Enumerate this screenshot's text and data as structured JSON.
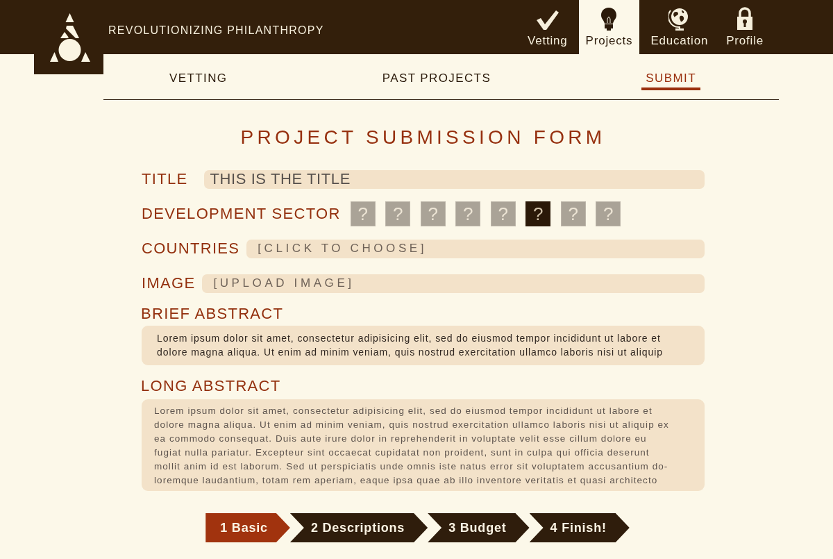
{
  "header": {
    "tagline": "REVOLUTIONIZING PHILANTHROPY"
  },
  "nav": [
    {
      "label": "Vetting",
      "selected": false
    },
    {
      "label": "Projects",
      "selected": true
    },
    {
      "label": "Education",
      "selected": false
    },
    {
      "label": "Profile",
      "selected": false
    }
  ],
  "subnav": [
    {
      "label": "VETTING",
      "selected": false
    },
    {
      "label": "PAST PROJECTS",
      "selected": false
    },
    {
      "label": "SUBMIT",
      "selected": true
    }
  ],
  "form": {
    "heading": "PROJECT SUBMISSION FORM",
    "title": {
      "label": "TITLE",
      "value": "THIS IS THE TITLE"
    },
    "sector": {
      "label": "DEVELOPMENT SECTOR",
      "options": [
        {
          "text": "?",
          "selected": false
        },
        {
          "text": "?",
          "selected": false
        },
        {
          "text": "?",
          "selected": false
        },
        {
          "text": "?",
          "selected": false
        },
        {
          "text": "?",
          "selected": false
        },
        {
          "text": "?",
          "selected": true
        },
        {
          "text": "?",
          "selected": false
        },
        {
          "text": "?",
          "selected": false
        }
      ]
    },
    "countries": {
      "label": "COUNTRIES",
      "placeholder": "[CLICK TO CHOOSE]"
    },
    "image": {
      "label": "IMAGE",
      "placeholder": "[UPLOAD IMAGE]"
    },
    "brief_abstract": {
      "label": "BRIEF ABSTRACT",
      "value": "Lorem ipsum dolor sit amet, consectetur adipisicing elit, sed do eiusmod tempor incididunt ut labore et\ndolore magna aliqua. Ut enim ad minim veniam, quis nostrud exercitation ullamco laboris nisi ut aliquip"
    },
    "long_abstract": {
      "label": "LONG ABSTRACT",
      "value": "Lorem ipsum dolor sit amet, consectetur adipisicing elit, sed do eiusmod tempor incididunt ut labore et\ndolore magna aliqua. Ut enim ad minim veniam, quis nostrud exercitation ullamco laboris nisi ut aliquip ex\nea commodo consequat. Duis aute irure dolor in reprehenderit in voluptate velit esse cillum dolore eu\nfugiat nulla pariatur. Excepteur sint occaecat cupidatat non proident, sunt in culpa qui officia deserunt\nmollit anim id est laborum. Sed ut perspiciatis unde omnis iste natus error sit voluptatem accusantium do-\nloremque laudantium, totam rem aperiam, eaque ipsa quae ab illo inventore veritatis et quasi architecto"
    }
  },
  "steps": [
    {
      "label": "1 Basic",
      "selected": true
    },
    {
      "label": "2 Descriptions",
      "selected": false
    },
    {
      "label": "3 Budget",
      "selected": false
    },
    {
      "label": "4 Finish!",
      "selected": false
    }
  ]
}
